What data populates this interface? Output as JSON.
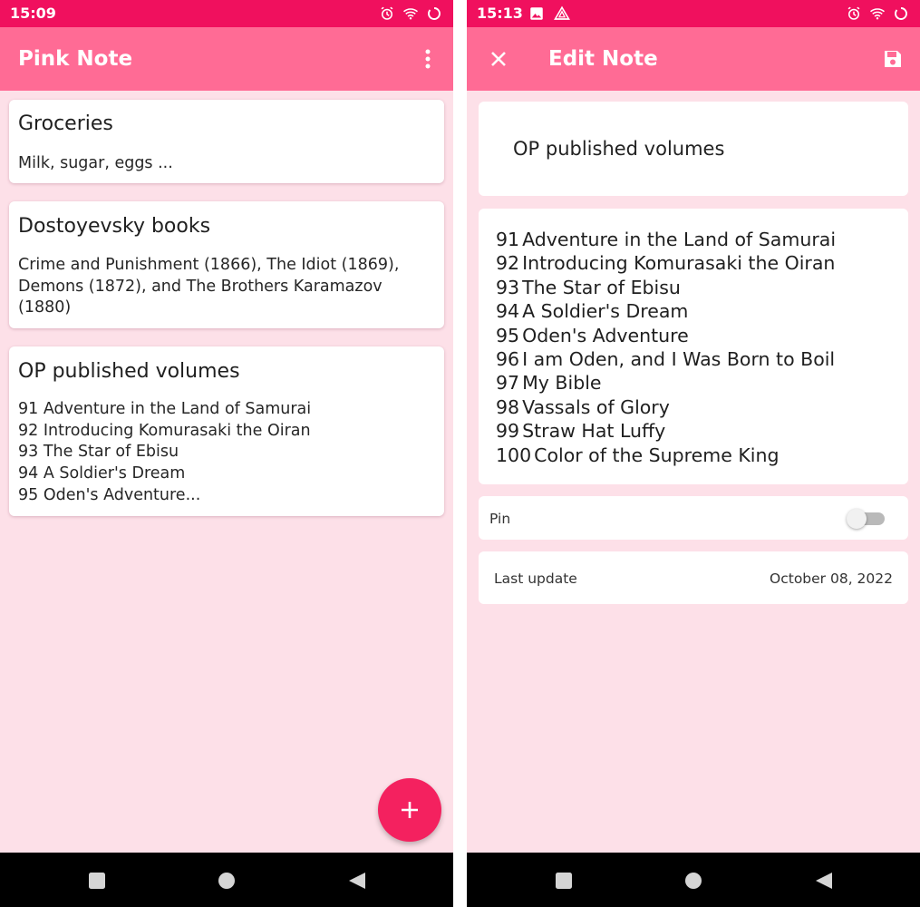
{
  "colors": {
    "status_bar": "#f0105e",
    "app_bar": "#ff6b95",
    "background": "#fde0e8",
    "fab": "#f4215f",
    "card": "#ffffff",
    "nav_bar": "#000000"
  },
  "left_screen": {
    "status_bar": {
      "time": "15:09",
      "icons": [
        "alarm-icon",
        "wifi-icon",
        "loading-circle-icon"
      ]
    },
    "app_bar": {
      "title": "Pink Note",
      "menu_icon": "more-vert-icon"
    },
    "notes": [
      {
        "title": "Groceries",
        "body": "Milk, sugar, eggs ..."
      },
      {
        "title": "Dostoyevsky books",
        "body": "Crime and Punishment (1866), The Idiot (1869),\nDemons (1872), and The Brothers Karamazov\n(1880)"
      },
      {
        "title": "OP published volumes",
        "body": "91 Adventure in the Land of Samurai\n92 Introducing Komurasaki the Oiran\n93 The Star of Ebisu\n94 A Soldier's Dream\n95 Oden's Adventure..."
      }
    ],
    "fab": {
      "label": "+",
      "icon": "add-icon"
    },
    "nav_bar": {
      "buttons": [
        "recents-square-icon",
        "home-circle-icon",
        "back-triangle-icon"
      ]
    }
  },
  "right_screen": {
    "status_bar": {
      "time": "15:13",
      "icons_left": [
        "image-icon",
        "warning-triangle-icon"
      ],
      "icons": [
        "alarm-icon",
        "wifi-icon",
        "loading-circle-icon"
      ]
    },
    "app_bar": {
      "title": "Edit Note",
      "close_icon": "close-icon",
      "save_icon": "save-floppy-icon"
    },
    "title_field": {
      "value": "OP published volumes"
    },
    "content_field": {
      "lines": [
        {
          "num": "91",
          "text": "Adventure in the Land of Samurai"
        },
        {
          "num": "92",
          "text": "Introducing Komurasaki the Oiran"
        },
        {
          "num": "93",
          "text": "The Star of Ebisu"
        },
        {
          "num": "94",
          "text": "A Soldier's Dream"
        },
        {
          "num": "95",
          "text": "Oden's Adventure"
        },
        {
          "num": "96",
          "text": "I am Oden, and I Was Born to Boil"
        },
        {
          "num": "97",
          "text": "My Bible"
        },
        {
          "num": "98",
          "text": "Vassals of Glory"
        },
        {
          "num": "99",
          "text": "Straw Hat Luffy"
        },
        {
          "num": "100",
          "text": "Color of the Supreme King"
        }
      ]
    },
    "pin": {
      "label": "Pin",
      "checked": false
    },
    "last_update": {
      "label": "Last update",
      "value": "October 08, 2022"
    },
    "nav_bar": {
      "buttons": [
        "recents-square-icon",
        "home-circle-icon",
        "back-triangle-icon"
      ]
    }
  }
}
